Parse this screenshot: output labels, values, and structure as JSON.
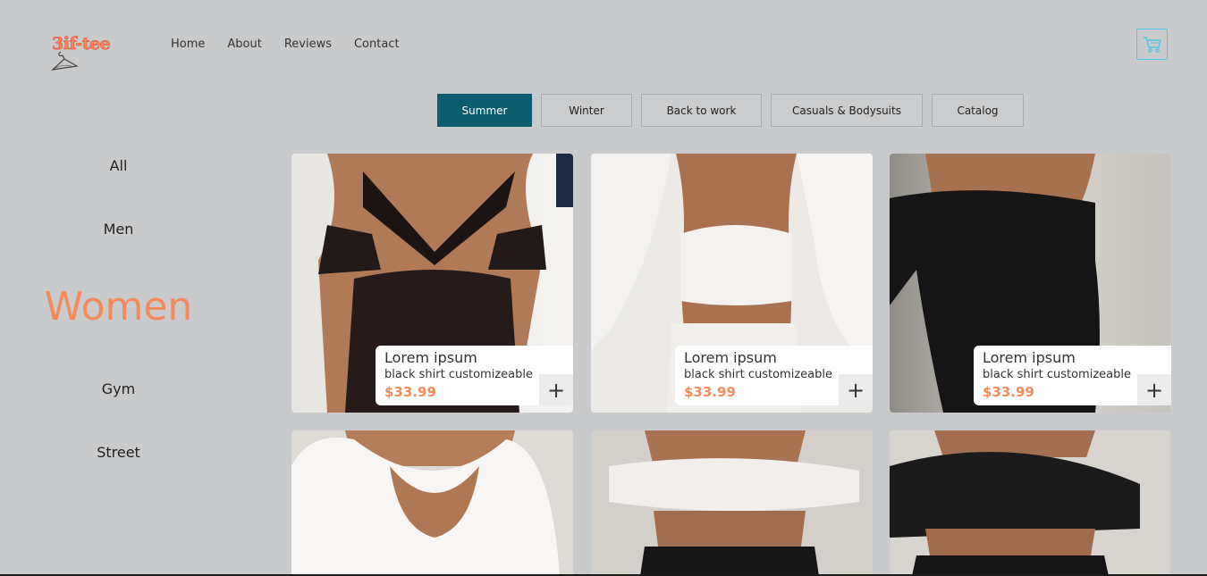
{
  "brand": {
    "logo_text": "3if-tee"
  },
  "nav": [
    "Home",
    "About",
    "Reviews",
    "Contact"
  ],
  "cart": {
    "icon": "cart-icon",
    "accent": "#4ec6e3"
  },
  "tabs": [
    {
      "label": "Summer",
      "active": true
    },
    {
      "label": "Winter",
      "active": false
    },
    {
      "label": "Back to work",
      "active": false
    },
    {
      "label": "Casuals & Bodysuits",
      "active": false
    },
    {
      "label": "Catalog",
      "active": false
    }
  ],
  "sidebar": [
    {
      "label": "All",
      "active": false
    },
    {
      "label": "Men",
      "active": false
    },
    {
      "label": "Women",
      "active": true
    },
    {
      "label": "Gym",
      "active": false
    },
    {
      "label": "Street",
      "active": false
    }
  ],
  "products": [
    {
      "name": "Lorem ipsum",
      "desc": "black shirt customizeable",
      "price": "$33.99",
      "add": "+",
      "garment": "black lace halter dress"
    },
    {
      "name": "Lorem ipsum",
      "desc": "black shirt customizeable",
      "price": "$33.99",
      "add": "+",
      "garment": "white fuzzy crop set"
    },
    {
      "name": "Lorem ipsum",
      "desc": "black shirt customizeable",
      "price": "$33.99",
      "add": "+",
      "garment": "black off-shoulder bodysuit"
    },
    {
      "garment": "white scoop-neck bodysuit"
    },
    {
      "garment": "white off-shoulder crop top"
    },
    {
      "garment": "black long-sleeve crop top"
    }
  ],
  "colors": {
    "accent": "#f58b5c",
    "active_tab": "#0b5d6e",
    "background": "#c9cacb"
  }
}
